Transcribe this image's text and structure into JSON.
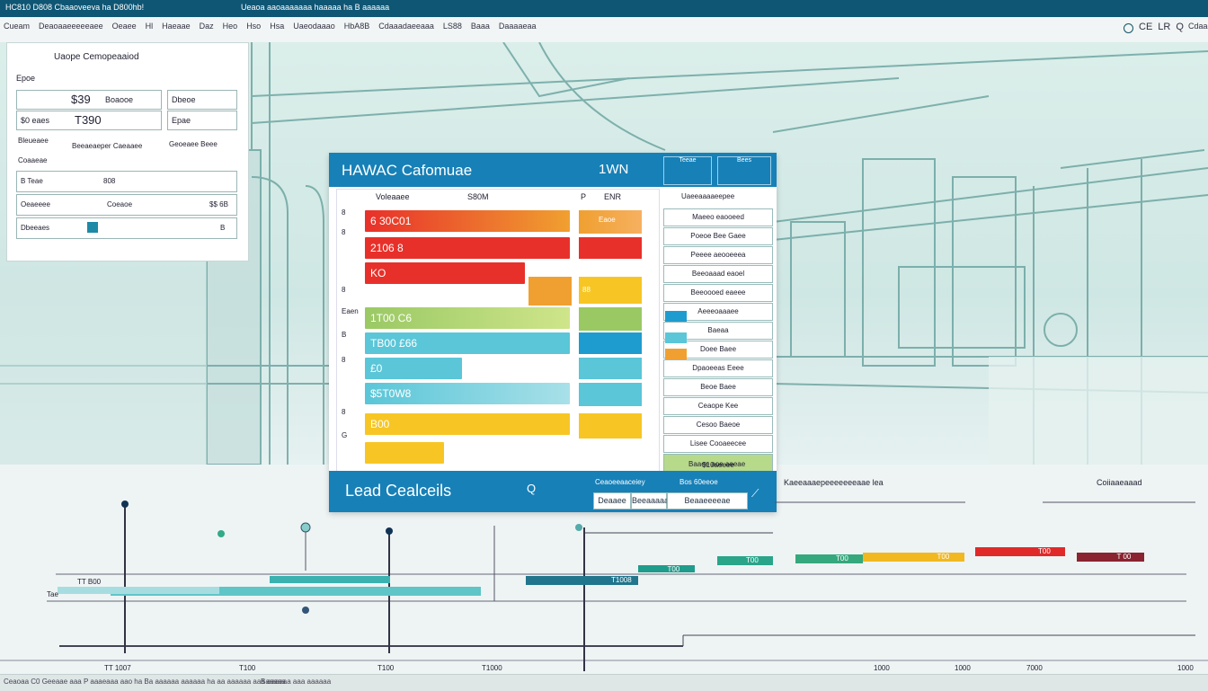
{
  "topbar": {
    "left_text": "HC810 D808 Cbaaoveeva ha D800hb!",
    "center_text": "Ueaoa aaoaaaaaaa haaaaa ha B aaaaaa"
  },
  "menubar": {
    "items": [
      "Cueam",
      "Deaoaaeeeeeaee",
      "Oeaee",
      "Hl",
      "Haeaae",
      "Daz",
      "Heo",
      "Hso",
      "Hsa",
      "Uaeodaaao",
      "HbA8B",
      "Cdaaadaeeaaa",
      "LS88",
      "Baaa",
      "Daaaaeaa"
    ],
    "right_text": "Cdaaeer",
    "right_icons": [
      "CE",
      "LR",
      "Q"
    ]
  },
  "left_panel": {
    "title": "Uaope Cemopeaaiod",
    "rows": [
      {
        "label": "Epoe",
        "value": "$39",
        "unit": "Boaooe",
        "right_label": "Dbeoe"
      },
      {
        "label": "$0 eaes",
        "value": "T390",
        "right_label": "Epae"
      },
      {
        "label": "Bleueaee",
        "col2": "Beeaeaeper Caeaaee",
        "col3": "Geoeaee Beee"
      },
      {
        "label": "Coaaeae"
      },
      {
        "label": "B Teae",
        "col2": "808"
      },
      {
        "label": "Oeaeeee",
        "col2": "Coeaoe",
        "col3": "$$ 6B"
      },
      {
        "label": "Dbeeaes",
        "col3": "B"
      }
    ]
  },
  "center_card": {
    "title": "HAWAC Cafomuae",
    "subtitle": "1WN",
    "header_right": [
      "Teeae",
      "Bees"
    ],
    "column_headers": [
      "Voleaaee",
      "S80M",
      "P",
      "ENR"
    ],
    "bar_labels_left": [
      "6 30C01",
      "2106 8",
      "KO",
      "1T00 C6",
      "TB00 £66",
      "£0",
      "$5T0W8",
      "B00"
    ],
    "side_labels": [
      "8",
      "8",
      "8",
      "Eaen",
      "B",
      "8",
      "8",
      "G"
    ],
    "right_bar_labels": [
      "Eaoe",
      "",
      "88"
    ],
    "right_panel_title": "Uaeeaaaaeepee",
    "right_list": [
      "Maeeo eaooeed",
      "Poeoe Bee Gaee",
      "Peeee aeooeeea",
      "Beeoaaad eaoel",
      "Beeoooed eaeee",
      "Aeeeoaaaee",
      "Baeaa",
      "Doee Baee",
      "Dpaoeeas Eeee",
      "Beoe Baee",
      "Ceaope Kee",
      "Cesoo Baeoe",
      "Lisee Cooaeecee",
      "$10aeeee"
    ],
    "right_panel_footer": "Baaee aoe aeeae",
    "footer_title": "Lead Cealceils",
    "footer_icon": "Q",
    "footer_link": "Ceaoeeaaceiey",
    "footer_link2": "Bos 60eeoe",
    "footer_buttons": [
      "Deaaee",
      "Beeaaaaa",
      "Beaaeeeeae"
    ]
  },
  "timeline": {
    "heading_left": "Kaeeaaaepeeeeeeeaae lea",
    "heading_right": "Coiiaaeaaad",
    "left_labels": [
      "Tae",
      "TT B00"
    ],
    "x_labels": [
      "TT 1007",
      "T100",
      "T100",
      "T1000",
      "1000",
      "1000",
      "7000",
      "1000"
    ],
    "bar_labels": [
      "T1008",
      "T00",
      "T00",
      "T00",
      "T00",
      "T00",
      "T 00"
    ],
    "bars": [
      {
        "color": "#5fc5c7",
        "start": 0.05,
        "end": 0.38
      },
      {
        "color": "#21758c",
        "start": 0.42,
        "end": 0.52
      },
      {
        "color": "#1f9c8c",
        "start": 0.52,
        "end": 0.57
      },
      {
        "color": "#2aa58a",
        "start": 0.59,
        "end": 0.64
      },
      {
        "color": "#35a87d",
        "start": 0.66,
        "end": 0.72
      },
      {
        "color": "#f2b820",
        "start": 0.72,
        "end": 0.81
      },
      {
        "color": "#e02a2a",
        "start": 0.82,
        "end": 0.9
      },
      {
        "color": "#8a2430",
        "start": 0.91,
        "end": 0.97
      }
    ]
  },
  "statusbar": {
    "text": "Ceaoaa C0 Geeaae aaa P aaaeaaa aao ha Ba aaaaaa aaaaaa ha aa aaaaaa aaa aaaaaa aaa aaaaaa",
    "right_text": "Baaaaa"
  },
  "colors": {
    "brand": "#1780b7",
    "teal": "#157b8b",
    "orange": "#f0a030",
    "red": "#e8302a",
    "yellow": "#f7c624",
    "green": "#9ac964",
    "cyan": "#5ac6d8"
  }
}
